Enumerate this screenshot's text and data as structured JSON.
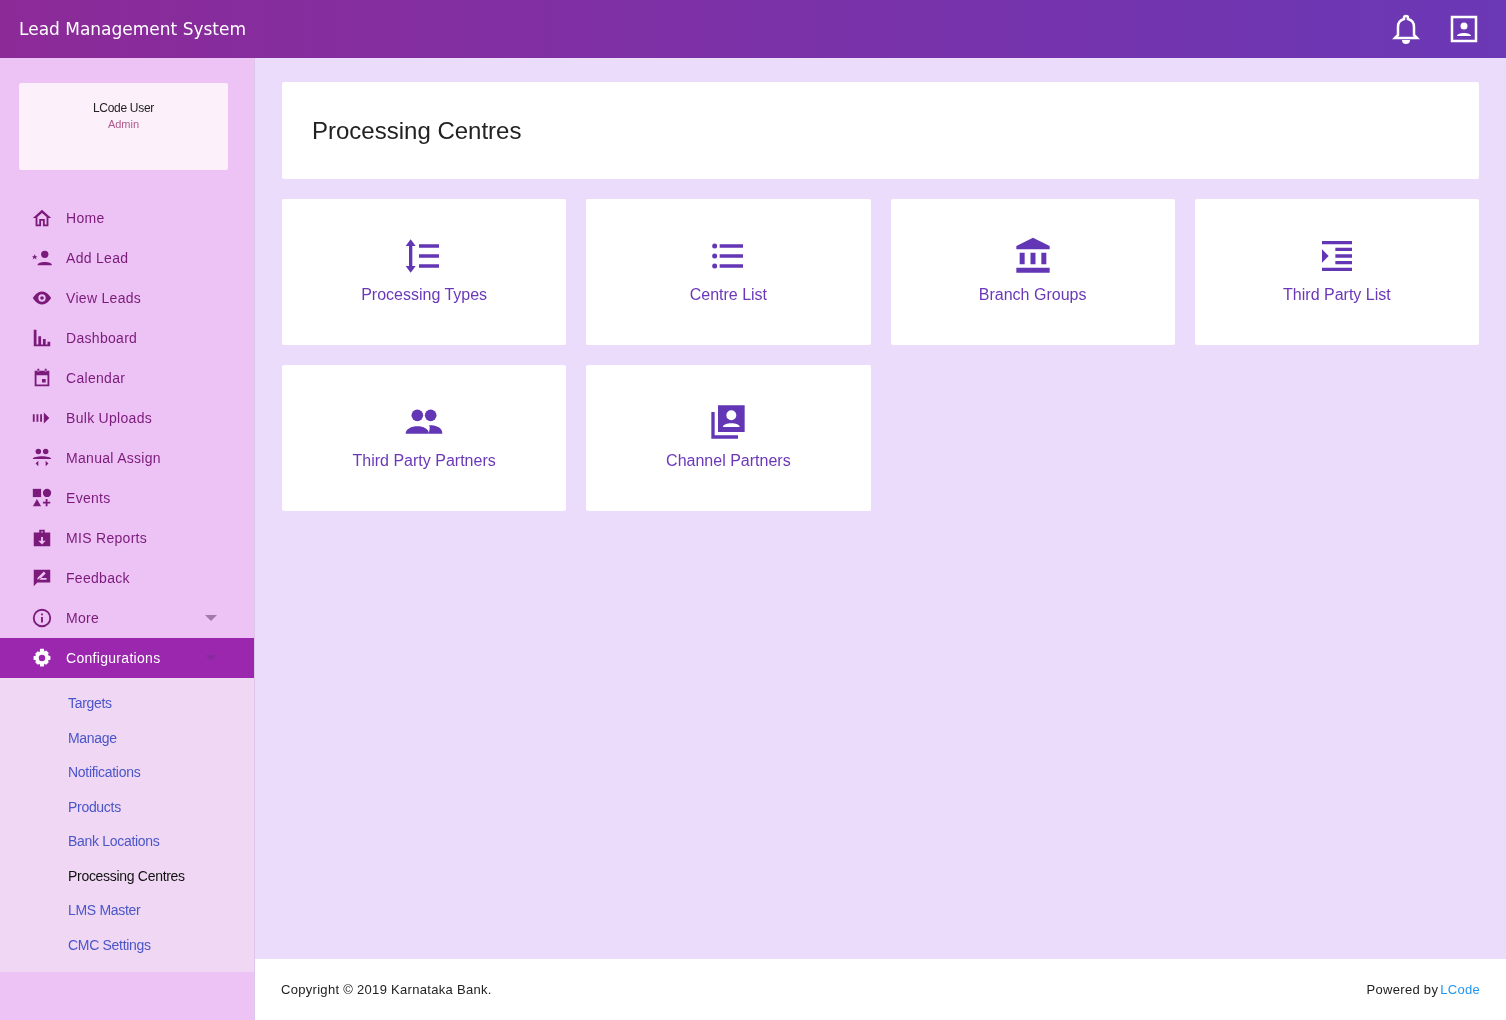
{
  "header": {
    "title": "Lead Management System"
  },
  "user": {
    "name": "LCode User",
    "role": "Admin"
  },
  "nav": [
    {
      "label": "Home",
      "selected": false,
      "dropdown": false
    },
    {
      "label": "Add Lead",
      "selected": false,
      "dropdown": false
    },
    {
      "label": "View Leads",
      "selected": false,
      "dropdown": false
    },
    {
      "label": "Dashboard",
      "selected": false,
      "dropdown": false
    },
    {
      "label": "Calendar",
      "selected": false,
      "dropdown": false
    },
    {
      "label": "Bulk Uploads",
      "selected": false,
      "dropdown": false
    },
    {
      "label": "Manual Assign",
      "selected": false,
      "dropdown": false
    },
    {
      "label": "Events",
      "selected": false,
      "dropdown": false
    },
    {
      "label": "MIS Reports",
      "selected": false,
      "dropdown": false
    },
    {
      "label": "Feedback",
      "selected": false,
      "dropdown": false
    },
    {
      "label": "More",
      "selected": false,
      "dropdown": true
    },
    {
      "label": "Configurations",
      "selected": true,
      "dropdown": true
    }
  ],
  "submenu": [
    {
      "label": "Targets",
      "selected": false
    },
    {
      "label": "Manage",
      "selected": false
    },
    {
      "label": "Notifications",
      "selected": false
    },
    {
      "label": "Products",
      "selected": false
    },
    {
      "label": "Bank Locations",
      "selected": false
    },
    {
      "label": "Processing Centres",
      "selected": true
    },
    {
      "label": "LMS Master",
      "selected": false
    },
    {
      "label": "CMC Settings",
      "selected": false
    }
  ],
  "page": {
    "title": "Processing Centres"
  },
  "tiles": [
    {
      "label": "Processing Types"
    },
    {
      "label": "Centre List"
    },
    {
      "label": "Branch Groups"
    },
    {
      "label": "Third Party List"
    },
    {
      "label": "Third Party Partners"
    },
    {
      "label": "Channel Partners"
    }
  ],
  "footer": {
    "copyright": "Copyright © 2019 Karnataka Bank.",
    "powered": "Powered by",
    "brand": "LCode"
  }
}
